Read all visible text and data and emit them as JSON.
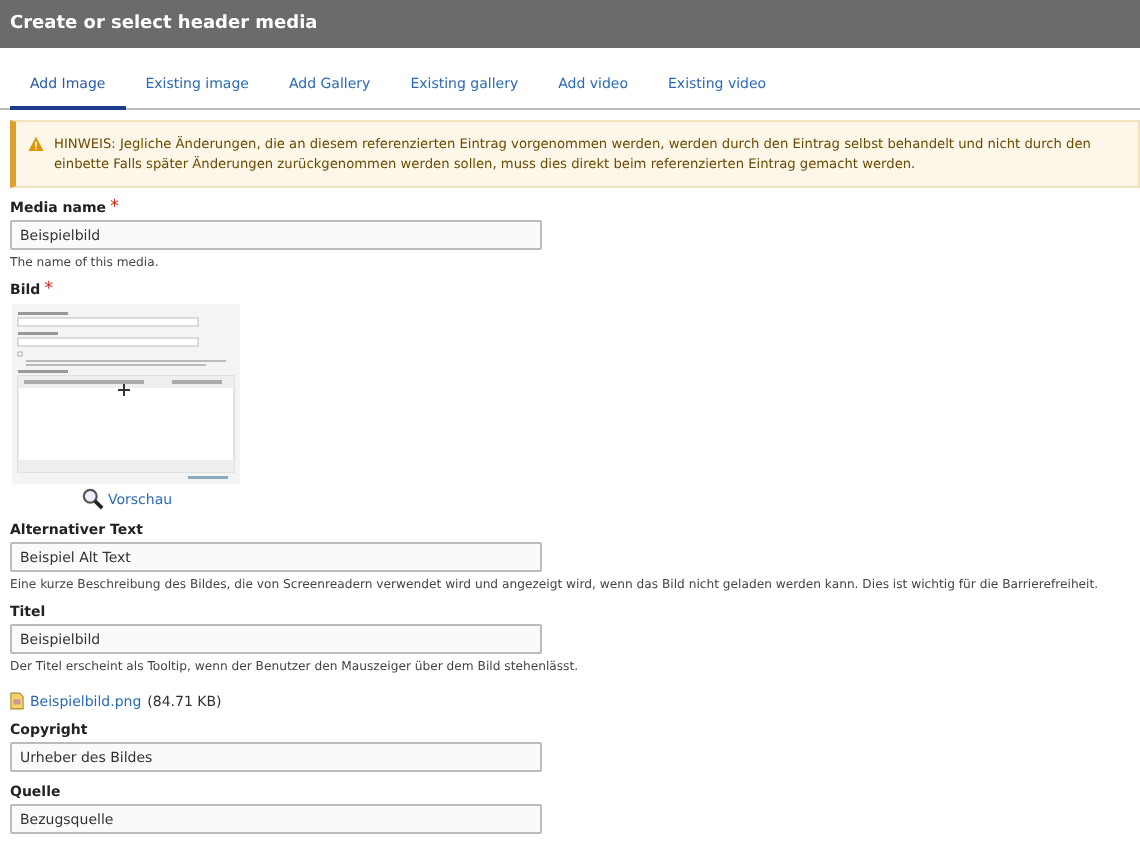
{
  "window": {
    "title": "Create or select header media"
  },
  "tabs": [
    {
      "label": "Add Image",
      "selected": true
    },
    {
      "label": "Existing image",
      "selected": false
    },
    {
      "label": "Add Gallery",
      "selected": false
    },
    {
      "label": "Existing gallery",
      "selected": false
    },
    {
      "label": "Add video",
      "selected": false
    },
    {
      "label": "Existing video",
      "selected": false
    }
  ],
  "notice": {
    "text": "HINWEIS: Jegliche Änderungen, die an diesem referenzierten Eintrag vorgenommen werden, werden durch den Eintrag selbst behandelt und nicht durch den einbette Falls später Änderungen zurückgenommen werden sollen, muss dies direkt beim referenzierten Eintrag gemacht werden."
  },
  "media_name": {
    "label": "Media name",
    "required_mark": "*",
    "value": "Beispielbild",
    "description": "The name of this media."
  },
  "image": {
    "label": "Bild",
    "required_mark": "*",
    "preview_link": "Vorschau"
  },
  "fields": [
    {
      "label": "Alternativer Text",
      "value": "Beispiel Alt Text",
      "description": "Eine kurze Beschreibung des Bildes, die von Screenreadern verwendet wird und angezeigt wird, wenn das Bild nicht geladen werden kann. Dies ist wichtig für die Barrierefreiheit."
    },
    {
      "label": "Titel",
      "value": "Beispielbild",
      "description": "Der Titel erscheint als Tooltip, wenn der Benutzer den Mauszeiger über dem Bild stehenlässt."
    }
  ],
  "file": {
    "name": "Beispielbild.png",
    "size": "(84.71 KB)"
  },
  "extra_fields": [
    {
      "label": "Copyright",
      "value": "Urheber des Bildes"
    },
    {
      "label": "Quelle",
      "value": "Bezugsquelle"
    }
  ]
}
